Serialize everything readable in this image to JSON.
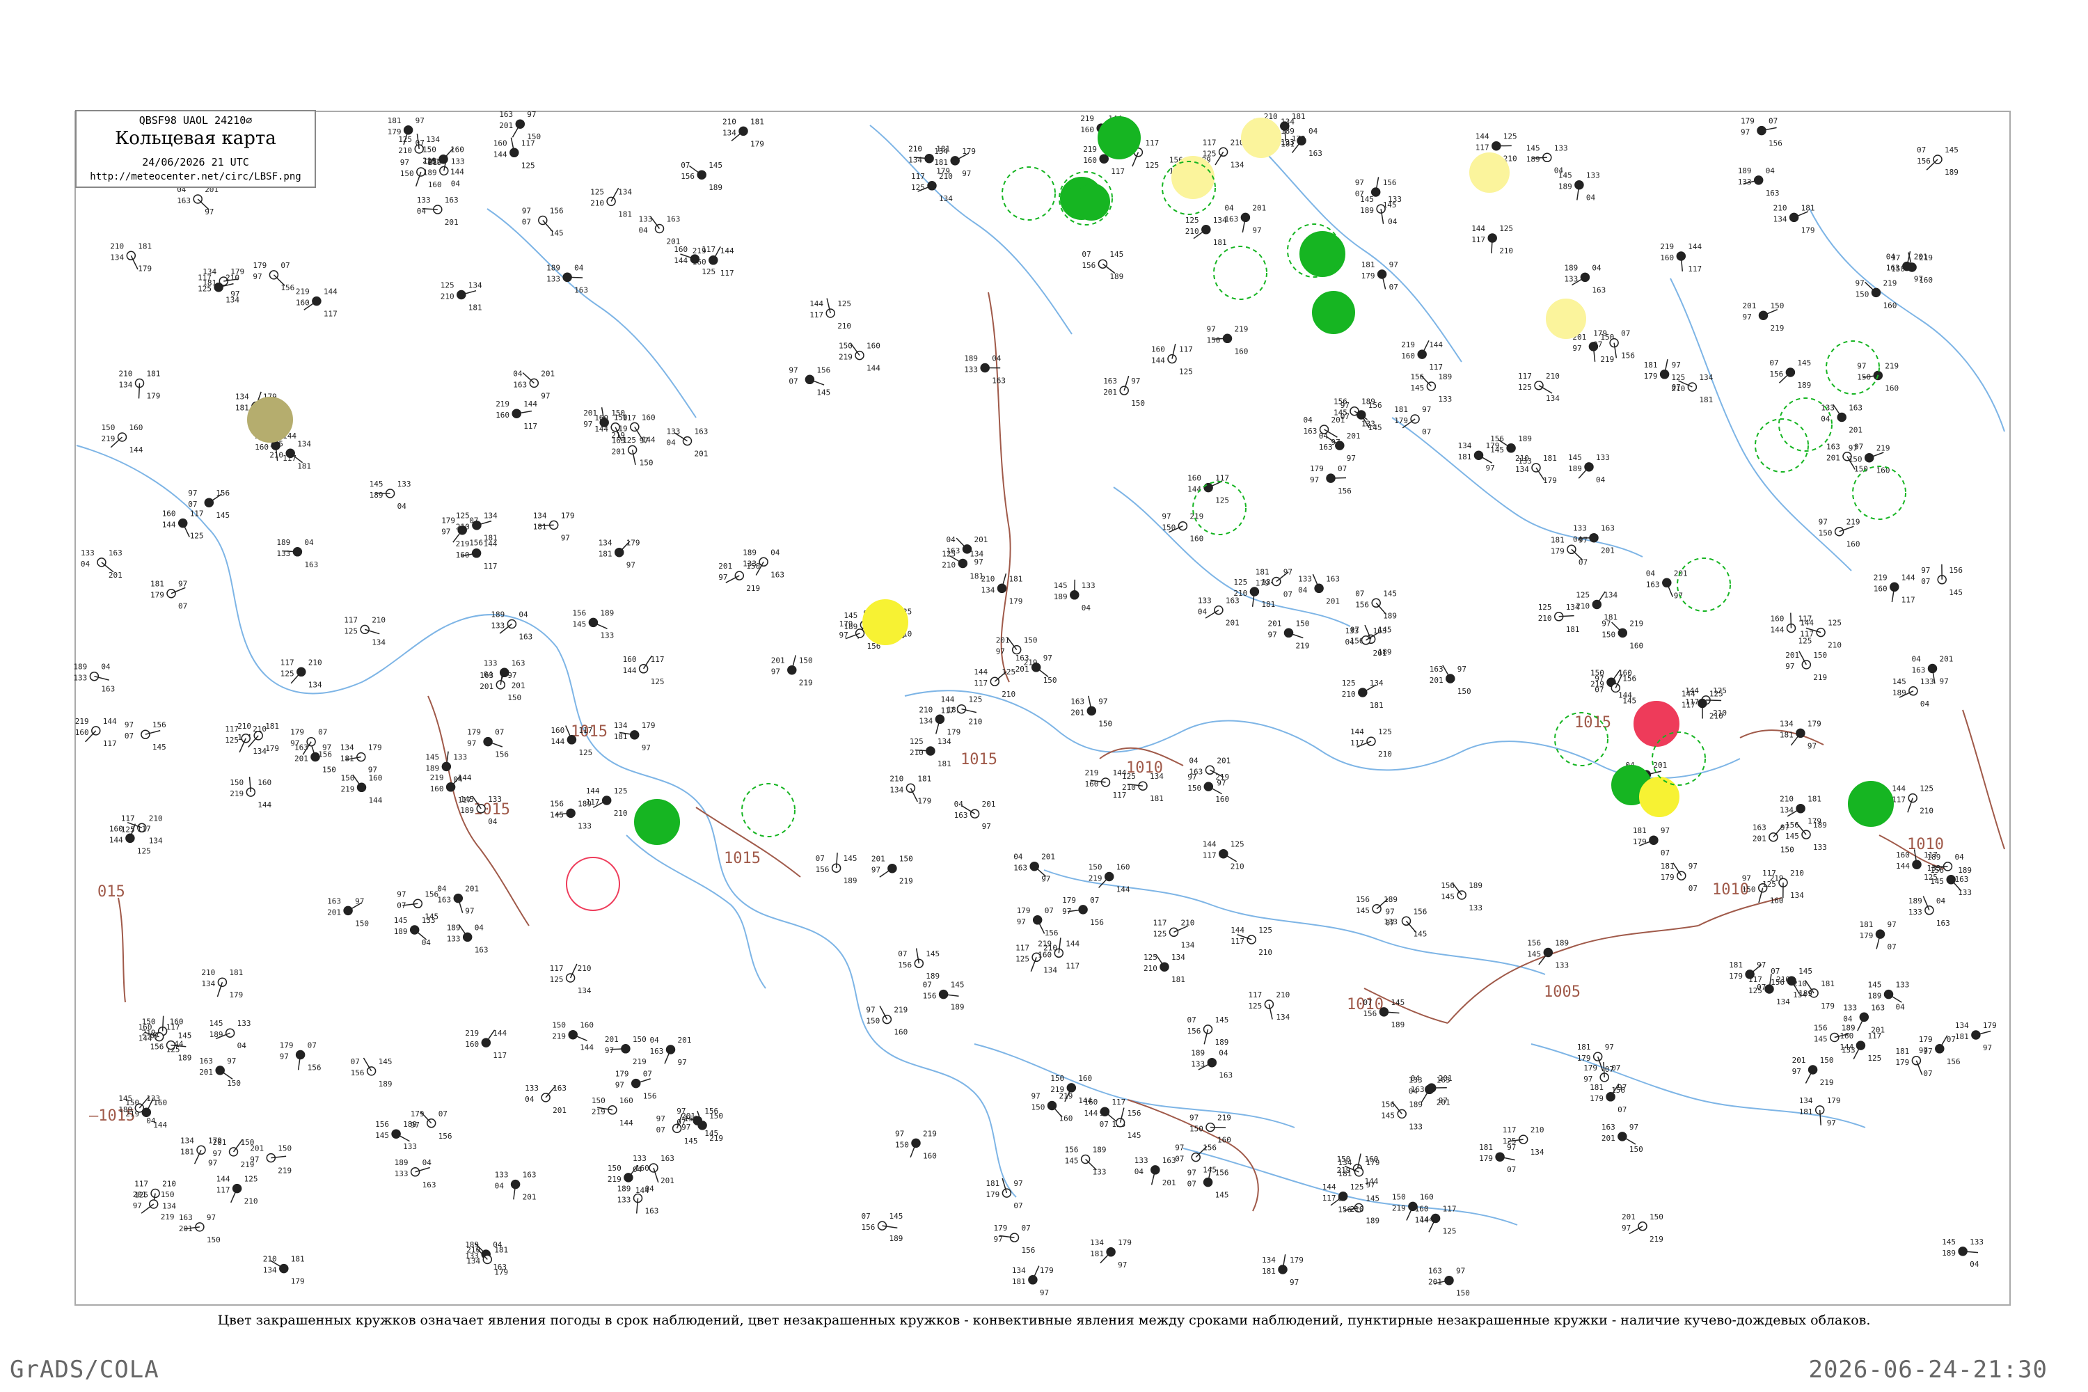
{
  "header": {
    "code": "QBSF98  UAOL  24210∅",
    "title": "Кольцевая карта",
    "date": "24/06/2026 21 UTC",
    "url": "http://meteocenter.net/circ/LBSF.png"
  },
  "caption": "Цвет закрашенных кружков означает явления погоды в срок наблюдений, цвет незакрашенных кружков - конвективные явления между сроками наблюдений, пунктирные незакрашенные кружки - наличие кучево-дождевых облаков.",
  "footer": {
    "left": "GrADS/COLA",
    "right": "2026-06-24-21:30"
  },
  "colors": {
    "coast": "#7eb5e6",
    "isobar": "#a05a4a",
    "green": "#16b522",
    "yellow": "#f7f233",
    "pale_yellow": "#fbf49c",
    "red": "#ee3b5a",
    "olive": "#b5ad6e",
    "station": "#222222",
    "frame": "#aaaaaa"
  },
  "isobar_labels": [
    "015",
    "1015",
    "1015",
    "1015",
    "1015",
    "1015",
    "1010",
    "1010",
    "1010",
    "1005",
    "1010",
    "—1015"
  ],
  "colored_circles": [
    {
      "id": "olive-west",
      "color": "olive"
    },
    {
      "id": "green-north-1",
      "color": "green"
    },
    {
      "id": "green-north-2",
      "color": "green"
    },
    {
      "id": "green-north-3",
      "color": "green"
    },
    {
      "id": "green-north-4",
      "color": "green"
    },
    {
      "id": "green-north-5",
      "color": "green"
    },
    {
      "id": "pale-yellow-1",
      "color": "pale_yellow"
    },
    {
      "id": "pale-yellow-2",
      "color": "pale_yellow"
    },
    {
      "id": "pale-yellow-3",
      "color": "pale_yellow"
    },
    {
      "id": "pale-yellow-4",
      "color": "pale_yellow"
    },
    {
      "id": "yellow-center",
      "color": "yellow"
    },
    {
      "id": "green-balkan",
      "color": "green"
    },
    {
      "id": "red-east",
      "color": "red"
    },
    {
      "id": "green-east-1",
      "color": "green"
    },
    {
      "id": "yellow-east",
      "color": "yellow"
    },
    {
      "id": "green-east-2",
      "color": "green"
    }
  ],
  "station_samples": [
    "179",
    "97",
    "07",
    "156",
    "145",
    "189",
    "133",
    "04",
    "163",
    "201",
    "97",
    "150",
    "219",
    "160",
    "144",
    "117",
    "125",
    "210",
    "134",
    "181"
  ]
}
